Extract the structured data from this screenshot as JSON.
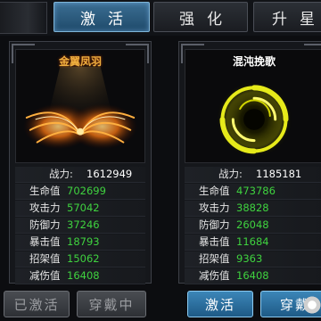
{
  "tabs": [
    {
      "label": "激活",
      "active": true
    },
    {
      "label": "强化",
      "active": false
    },
    {
      "label": "升星",
      "active": false
    }
  ],
  "cards": [
    {
      "name": "金翼凤羽",
      "art_icon": "golden-wings-icon",
      "power_label": "战力:",
      "power_value": "1612949",
      "stats": [
        {
          "label": "生命值",
          "value": "702699"
        },
        {
          "label": "攻击力",
          "value": "57042"
        },
        {
          "label": "防御力",
          "value": "37246"
        },
        {
          "label": "暴击值",
          "value": "18793"
        },
        {
          "label": "招架值",
          "value": "15062"
        },
        {
          "label": "减伤值",
          "value": "16408"
        }
      ],
      "buttons": [
        "已激活",
        "穿戴中"
      ]
    },
    {
      "name": "混沌挽歌",
      "art_icon": "chaos-vortex-icon",
      "power_label": "战力:",
      "power_value": "1185181",
      "stats": [
        {
          "label": "生命值",
          "value": "473786"
        },
        {
          "label": "攻击力",
          "value": "38828"
        },
        {
          "label": "防御力",
          "value": "26048"
        },
        {
          "label": "暴击值",
          "value": "11684"
        },
        {
          "label": "招架值",
          "value": "9363"
        },
        {
          "label": "减伤值",
          "value": "16408"
        }
      ],
      "buttons": [
        "激活",
        "穿戴"
      ]
    }
  ],
  "colors": {
    "stat_value": "#3fd23f",
    "active_tab": "#2f5f83",
    "gold_title": "#f0b040"
  }
}
